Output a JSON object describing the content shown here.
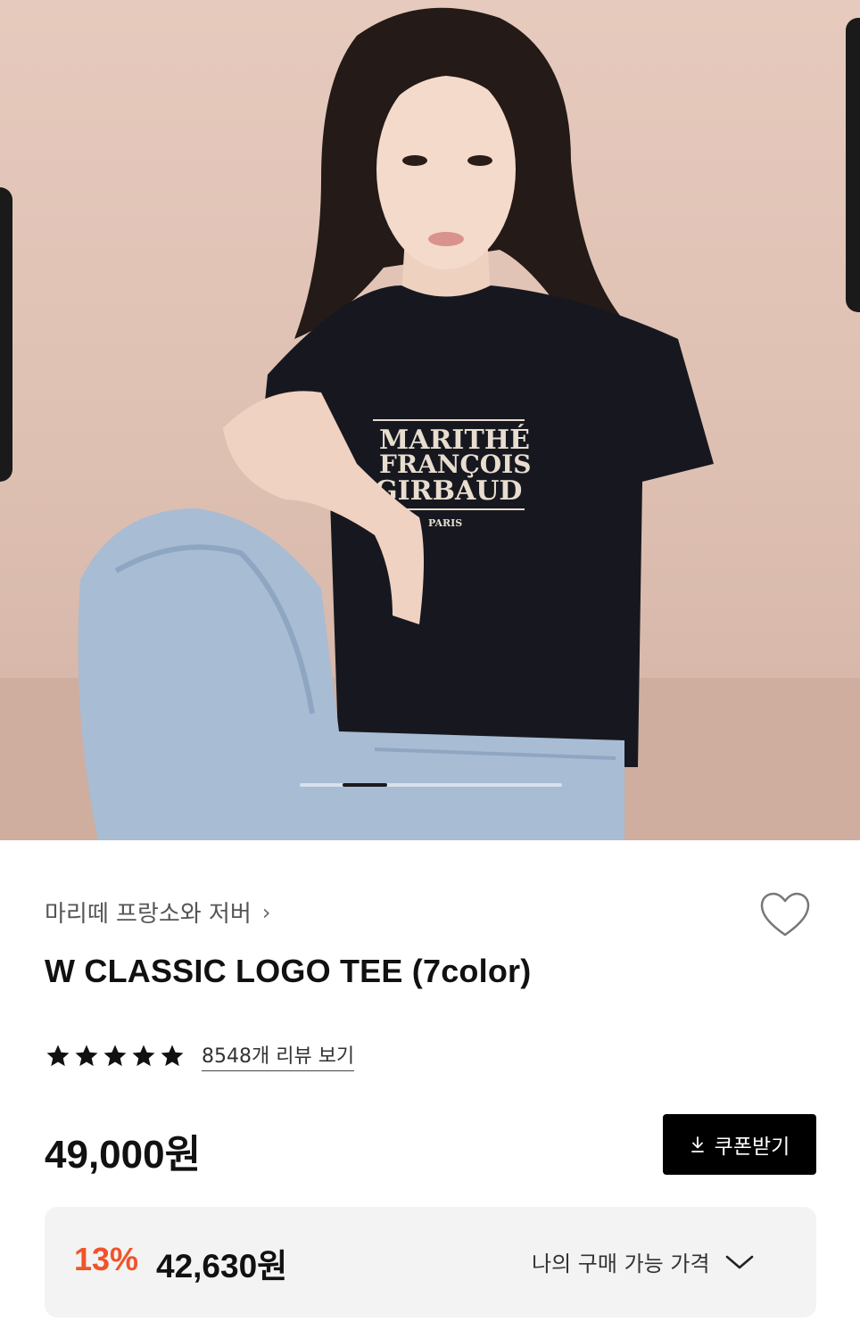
{
  "product": {
    "image": {
      "alt": "Model wearing a black logo t-shirt and light wash jeans",
      "shirt_print": [
        "MARITHÉ",
        "FRANÇOIS",
        "GIRBAUD",
        "PARIS"
      ]
    },
    "brand": "마리떼 프랑소와 저버",
    "title": "W CLASSIC LOGO TEE (7color)",
    "rating_stars": 5,
    "review_link": "8548개 리뷰 보기",
    "price": "49,000원",
    "coupon_button": "쿠폰받기",
    "discount_percent": "13%",
    "discount_price": "42,630원",
    "my_price_label": "나의 구매 가능 가격"
  },
  "carousel": {
    "active_index": 1
  },
  "colors": {
    "accent_discount": "#f0542a",
    "button_bg": "#000000",
    "sale_box_bg": "#f3f3f3",
    "backdrop": "#e6cabd"
  },
  "icons": {
    "brand_chevron": "chevron-right-icon",
    "wishlist": "heart-outline-icon",
    "coupon": "download-arrow-icon",
    "expand": "chevron-down-icon",
    "star": "star-filled-icon"
  }
}
